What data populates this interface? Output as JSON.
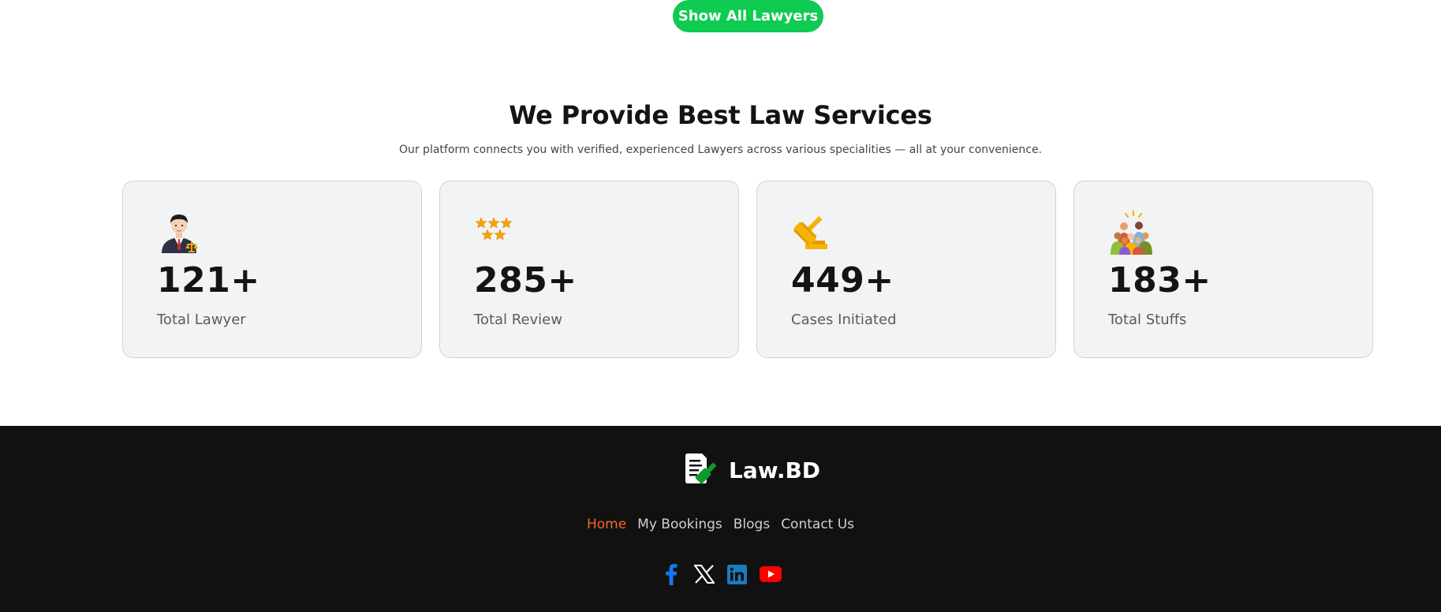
{
  "top_button": {
    "label": "Show All Lawyers",
    "color": "#0fcb52"
  },
  "services": {
    "title": "We Provide Best Law Services",
    "subtitle": "Our platform connects you with verified, experienced Lawyers across various specialities — all at your convenience.",
    "stats": [
      {
        "icon": "lawyer-icon",
        "value": "121+",
        "label": "Total Lawyer"
      },
      {
        "icon": "stars-icon",
        "value": "285+",
        "label": "Total Review"
      },
      {
        "icon": "gavel-icon",
        "value": "449+",
        "label": "Cases Initiated"
      },
      {
        "icon": "group-icon",
        "value": "183+",
        "label": "Total Stuffs"
      }
    ]
  },
  "footer": {
    "brand": "Law.BD",
    "nav": [
      {
        "label": "Home",
        "active": true
      },
      {
        "label": "My Bookings",
        "active": false
      },
      {
        "label": "Blogs",
        "active": false
      },
      {
        "label": "Contact Us",
        "active": false
      }
    ],
    "socials": [
      "facebook-icon",
      "x-icon",
      "linkedin-icon",
      "youtube-icon"
    ],
    "colors": {
      "background": "#111111",
      "active_link": "#f26a21"
    }
  }
}
